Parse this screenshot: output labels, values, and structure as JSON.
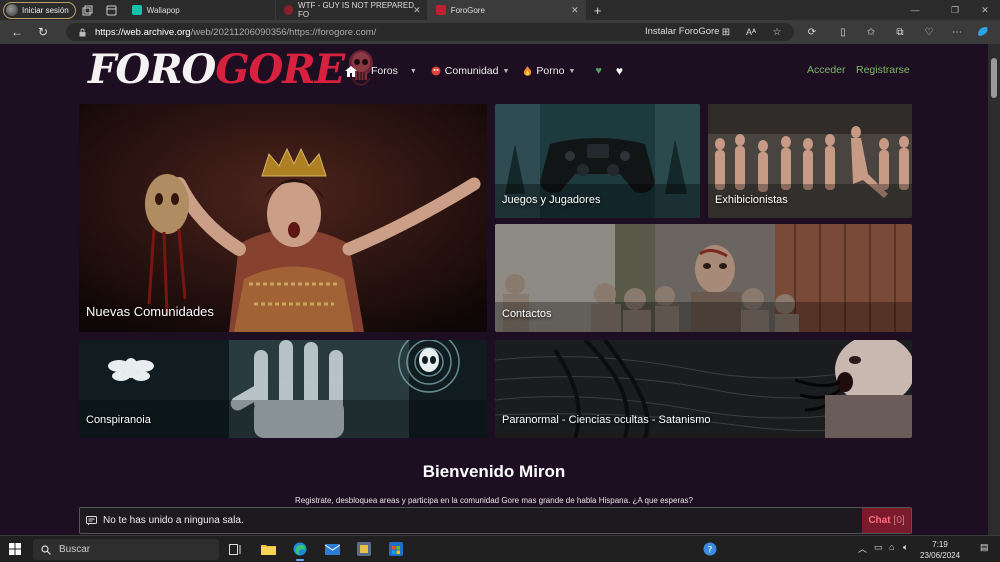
{
  "browser": {
    "profile_label": "Iniciar sesión",
    "tabs": [
      {
        "title": "Wallapop"
      },
      {
        "title": "WTF - GUY IS NOT PREPARED FO"
      },
      {
        "title": "ForoGore"
      }
    ],
    "url_host": "https://web.archive.org",
    "url_path": "/web/20211206090356/https://forogore.com/",
    "install_label": "Instalar ForoGore"
  },
  "site": {
    "logo_foro": "FORO",
    "logo_gore": "GORE",
    "menu": {
      "foros": "Foros",
      "comunidad": "Comunidad",
      "porno": "Porno"
    },
    "login": "Acceder",
    "register": "Registrarse",
    "tiles": [
      {
        "label": "Nuevas Comunidades"
      },
      {
        "label": "Juegos y Jugadores"
      },
      {
        "label": "Exhibicionistas"
      },
      {
        "label": "Contactos"
      },
      {
        "label": "Conspiranoia"
      },
      {
        "label": "Paranormal - Ciencias ocultas - Satanismo"
      }
    ],
    "welcome": "Bienvenido Miron",
    "subline": "Registrate, desbloquea areas y participa en la comunidad Gore mas grande de habla Hispana. ¿A que esperas?",
    "chat_message": "No te has unido a ninguna sala.",
    "chat_label": "Chat",
    "chat_count": "[0]"
  },
  "taskbar": {
    "search": "Buscar",
    "time": "7:19",
    "date": "23/06/2024"
  }
}
